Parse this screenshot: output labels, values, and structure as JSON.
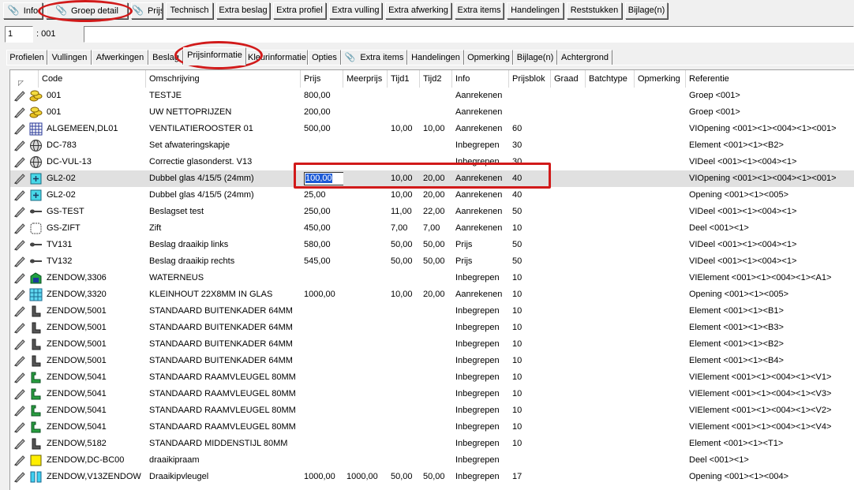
{
  "toolbar": {
    "buttons": [
      "Info",
      "Groep detail",
      "Prijs",
      "Technisch",
      "Extra beslag",
      "Extra profiel",
      "Extra vulling",
      "Extra afwerking",
      "Extra items",
      "Handelingen",
      "Reststukken",
      "Bijlage(n)"
    ]
  },
  "id_row": {
    "number": "1",
    "label": ": 001"
  },
  "tabs": [
    "Profielen",
    "Vullingen",
    "Afwerkingen",
    "Beslag",
    "Prijsinformatie",
    "Kleurinformatie",
    "Opties",
    "Extra items",
    "Handelingen",
    "Opmerking",
    "Bijlage(n)",
    "Achtergrond"
  ],
  "active_tab": "Prijsinformatie",
  "columns": [
    "Code",
    "Omschrijving",
    "Prijs",
    "Meerprijs",
    "Tijd1",
    "Tijd2",
    "Info",
    "Prijsblok",
    "Graad",
    "Batchtype",
    "Opmerking",
    "Referentie"
  ],
  "rows": [
    {
      "icon": "coins-icon",
      "code": "001",
      "omschrijving": "TESTJE",
      "prijs": "800,00",
      "meerprijs": "",
      "tijd1": "",
      "tijd2": "",
      "info": "Aanrekenen",
      "prijsblok": "",
      "referentie": "Groep <001>"
    },
    {
      "icon": "coins-icon",
      "code": "001",
      "omschrijving": "UW NETTOPRIJZEN",
      "prijs": "200,00",
      "meerprijs": "",
      "tijd1": "",
      "tijd2": "",
      "info": "Aanrekenen",
      "prijsblok": "",
      "referentie": "Groep <001>"
    },
    {
      "icon": "vent-grille-icon",
      "code": "ALGEMEEN,DL01",
      "omschrijving": "VENTILATIEROOSTER 01",
      "prijs": "500,00",
      "meerprijs": "",
      "tijd1": "10,00",
      "tijd2": "10,00",
      "info": "Aanrekenen",
      "prijsblok": "60",
      "referentie": "VIOpening <001><1><004><1><001>"
    },
    {
      "icon": "globe-icon",
      "code": "DC-783",
      "omschrijving": "Set afwateringskapje",
      "prijs": "",
      "meerprijs": "",
      "tijd1": "",
      "tijd2": "",
      "info": "Inbegrepen",
      "prijsblok": "30",
      "referentie": "Element <001><1><B2>"
    },
    {
      "icon": "globe-icon",
      "code": "DC-VUL-13",
      "omschrijving": "Correctie glasonderst. V13",
      "prijs": "",
      "meerprijs": "",
      "tijd1": "",
      "tijd2": "",
      "info": "Inbegrepen",
      "prijsblok": "30",
      "referentie": "VIDeel <001><1><004><1>"
    },
    {
      "icon": "glass-icon",
      "code": "GL2-02",
      "omschrijving": "Dubbel glas 4/15/5 (24mm)",
      "prijs": "100,00",
      "meerprijs": "",
      "tijd1": "10,00",
      "tijd2": "20,00",
      "info": "Aanrekenen",
      "prijsblok": "40",
      "referentie": "VIOpening <001><1><004><1><001>"
    },
    {
      "icon": "glass-icon",
      "code": "GL2-02",
      "omschrijving": "Dubbel glas 4/15/5 (24mm)",
      "prijs": "25,00",
      "meerprijs": "",
      "tijd1": "10,00",
      "tijd2": "20,00",
      "info": "Aanrekenen",
      "prijsblok": "40",
      "referentie": "Opening <001><1><005>"
    },
    {
      "icon": "key-icon",
      "code": "GS-TEST",
      "omschrijving": "Beslagset test",
      "prijs": "250,00",
      "meerprijs": "",
      "tijd1": "11,00",
      "tijd2": "22,00",
      "info": "Aanrekenen",
      "prijsblok": "50",
      "referentie": "VIDeel <001><1><004><1>"
    },
    {
      "icon": "zift-icon",
      "code": "GS-ZIFT",
      "omschrijving": "Zift",
      "prijs": "450,00",
      "meerprijs": "",
      "tijd1": "7,00",
      "tijd2": "7,00",
      "info": "Aanrekenen",
      "prijsblok": "10",
      "referentie": "Deel <001><1>"
    },
    {
      "icon": "key-icon",
      "code": "TV131",
      "omschrijving": "Beslag draaikip links",
      "prijs": "580,00",
      "meerprijs": "",
      "tijd1": "50,00",
      "tijd2": "50,00",
      "info": "Prijs",
      "prijsblok": "50",
      "referentie": "VIDeel <001><1><004><1>"
    },
    {
      "icon": "key-icon",
      "code": "TV132",
      "omschrijving": "Beslag draaikip rechts",
      "prijs": "545,00",
      "meerprijs": "",
      "tijd1": "50,00",
      "tijd2": "50,00",
      "info": "Prijs",
      "prijsblok": "50",
      "referentie": "VIDeel <001><1><004><1>"
    },
    {
      "icon": "waterneus-icon",
      "code": "ZENDOW,3306",
      "omschrijving": "WATERNEUS",
      "prijs": "",
      "meerprijs": "",
      "tijd1": "",
      "tijd2": "",
      "info": "Inbegrepen",
      "prijsblok": "10",
      "referentie": "VIElement <001><1><004><1><A1>"
    },
    {
      "icon": "grid-icon",
      "code": "ZENDOW,3320",
      "omschrijving": "KLEINHOUT 22X8MM IN GLAS",
      "prijs": "1000,00",
      "meerprijs": "",
      "tijd1": "10,00",
      "tijd2": "20,00",
      "info": "Aanrekenen",
      "prijsblok": "10",
      "referentie": "Opening <001><1><005>"
    },
    {
      "icon": "frame-profile-icon",
      "code": "ZENDOW,5001",
      "omschrijving": "STANDAARD BUITENKADER 64MM",
      "prijs": "",
      "meerprijs": "",
      "tijd1": "",
      "tijd2": "",
      "info": "Inbegrepen",
      "prijsblok": "10",
      "referentie": "Element <001><1><B1>"
    },
    {
      "icon": "frame-profile-icon",
      "code": "ZENDOW,5001",
      "omschrijving": "STANDAARD BUITENKADER 64MM",
      "prijs": "",
      "meerprijs": "",
      "tijd1": "",
      "tijd2": "",
      "info": "Inbegrepen",
      "prijsblok": "10",
      "referentie": "Element <001><1><B3>"
    },
    {
      "icon": "frame-profile-icon",
      "code": "ZENDOW,5001",
      "omschrijving": "STANDAARD BUITENKADER 64MM",
      "prijs": "",
      "meerprijs": "",
      "tijd1": "",
      "tijd2": "",
      "info": "Inbegrepen",
      "prijsblok": "10",
      "referentie": "Element <001><1><B2>"
    },
    {
      "icon": "frame-profile-icon",
      "code": "ZENDOW,5001",
      "omschrijving": "STANDAARD BUITENKADER 64MM",
      "prijs": "",
      "meerprijs": "",
      "tijd1": "",
      "tijd2": "",
      "info": "Inbegrepen",
      "prijsblok": "10",
      "referentie": "Element <001><1><B4>"
    },
    {
      "icon": "sash-profile-icon",
      "code": "ZENDOW,5041",
      "omschrijving": "STANDAARD RAAMVLEUGEL 80MM",
      "prijs": "",
      "meerprijs": "",
      "tijd1": "",
      "tijd2": "",
      "info": "Inbegrepen",
      "prijsblok": "10",
      "referentie": "VIElement <001><1><004><1><V1>"
    },
    {
      "icon": "sash-profile-icon",
      "code": "ZENDOW,5041",
      "omschrijving": "STANDAARD RAAMVLEUGEL 80MM",
      "prijs": "",
      "meerprijs": "",
      "tijd1": "",
      "tijd2": "",
      "info": "Inbegrepen",
      "prijsblok": "10",
      "referentie": "VIElement <001><1><004><1><V3>"
    },
    {
      "icon": "sash-profile-icon",
      "code": "ZENDOW,5041",
      "omschrijving": "STANDAARD RAAMVLEUGEL 80MM",
      "prijs": "",
      "meerprijs": "",
      "tijd1": "",
      "tijd2": "",
      "info": "Inbegrepen",
      "prijsblok": "10",
      "referentie": "VIElement <001><1><004><1><V2>"
    },
    {
      "icon": "sash-profile-icon",
      "code": "ZENDOW,5041",
      "omschrijving": "STANDAARD RAAMVLEUGEL 80MM",
      "prijs": "",
      "meerprijs": "",
      "tijd1": "",
      "tijd2": "",
      "info": "Inbegrepen",
      "prijsblok": "10",
      "referentie": "VIElement <001><1><004><1><V4>"
    },
    {
      "icon": "frame-profile-icon",
      "code": "ZENDOW,5182",
      "omschrijving": "STANDAARD MIDDENSTIJL 80MM",
      "prijs": "",
      "meerprijs": "",
      "tijd1": "",
      "tijd2": "",
      "info": "Inbegrepen",
      "prijsblok": "10",
      "referentie": "Element <001><1><T1>"
    },
    {
      "icon": "yellow-square-icon",
      "code": "ZENDOW,DC-BC00",
      "omschrijving": "draaikipraam",
      "prijs": "",
      "meerprijs": "",
      "tijd1": "",
      "tijd2": "",
      "info": "Inbegrepen",
      "prijsblok": "",
      "referentie": "Deel <001><1>"
    },
    {
      "icon": "sash-double-icon",
      "code": "ZENDOW,V13ZENDOW",
      "omschrijving": "Draaikipvleugel",
      "prijs": "1000,00",
      "meerprijs": "1000,00",
      "tijd1": "50,00",
      "tijd2": "50,00",
      "info": "Inbegrepen",
      "prijsblok": "17",
      "referentie": "Opening <001><1><004>"
    }
  ],
  "selected_row": 5,
  "colors": {
    "highlight": "#d11a1a",
    "selection": "#1e5bd6",
    "row_selected_bg": "#e0e0e0"
  }
}
